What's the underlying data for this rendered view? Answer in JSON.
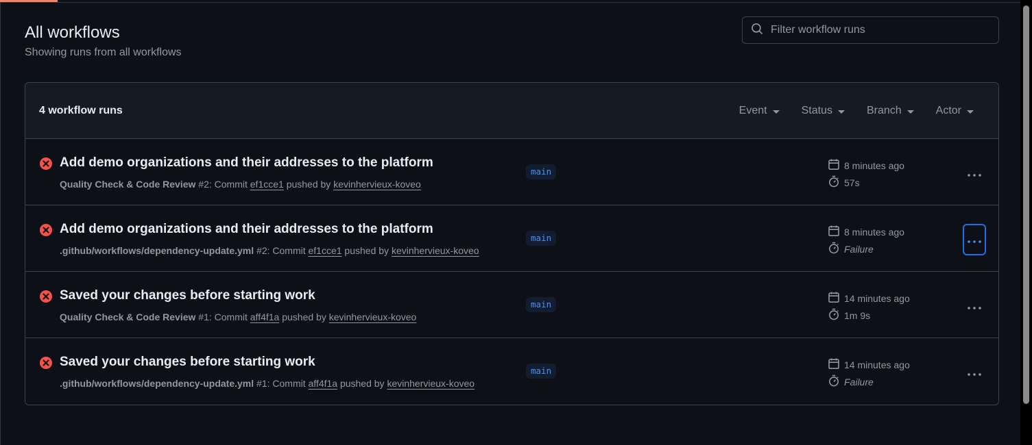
{
  "page": {
    "title": "All workflows",
    "subtitle": "Showing runs from all workflows"
  },
  "search": {
    "placeholder": "Filter workflow runs",
    "icon": "search-icon"
  },
  "list": {
    "count_label": "4 workflow runs",
    "filters": [
      {
        "label": "Event"
      },
      {
        "label": "Status"
      },
      {
        "label": "Branch"
      },
      {
        "label": "Actor"
      }
    ],
    "runs": [
      {
        "status": "failure",
        "title": "Add demo organizations and their addresses to the platform",
        "workflow": "Quality Check & Code Review",
        "run_number": " #2: Commit ",
        "commit": "ef1cce1",
        "pushed_by": " pushed by ",
        "actor": "kevinhervieux-koveo",
        "branch": "main",
        "time_ago": "8 minutes ago",
        "duration": "57s",
        "duration_italic": false,
        "menu_focused": false
      },
      {
        "status": "failure",
        "title": "Add demo organizations and their addresses to the platform",
        "workflow": ".github/workflows/dependency-update.yml",
        "run_number": " #2: Commit ",
        "commit": "ef1cce1",
        "pushed_by": " pushed by ",
        "actor": "kevinhervieux-koveo",
        "branch": "main",
        "time_ago": "8 minutes ago",
        "duration": "Failure",
        "duration_italic": true,
        "menu_focused": true
      },
      {
        "status": "failure",
        "title": "Saved your changes before starting work",
        "workflow": "Quality Check & Code Review",
        "run_number": " #1: Commit ",
        "commit": "aff4f1a",
        "pushed_by": " pushed by ",
        "actor": "kevinhervieux-koveo",
        "branch": "main",
        "time_ago": "14 minutes ago",
        "duration": "1m 9s",
        "duration_italic": false,
        "menu_focused": false
      },
      {
        "status": "failure",
        "title": "Saved your changes before starting work",
        "workflow": ".github/workflows/dependency-update.yml",
        "run_number": " #1: Commit ",
        "commit": "aff4f1a",
        "pushed_by": " pushed by ",
        "actor": "kevinhervieux-koveo",
        "branch": "main",
        "time_ago": "14 minutes ago",
        "duration": "Failure",
        "duration_italic": true,
        "menu_focused": false
      }
    ]
  },
  "colors": {
    "background": "#0d1117",
    "failure": "#f85149",
    "accent": "#4493f8",
    "muted": "#9198a1"
  }
}
